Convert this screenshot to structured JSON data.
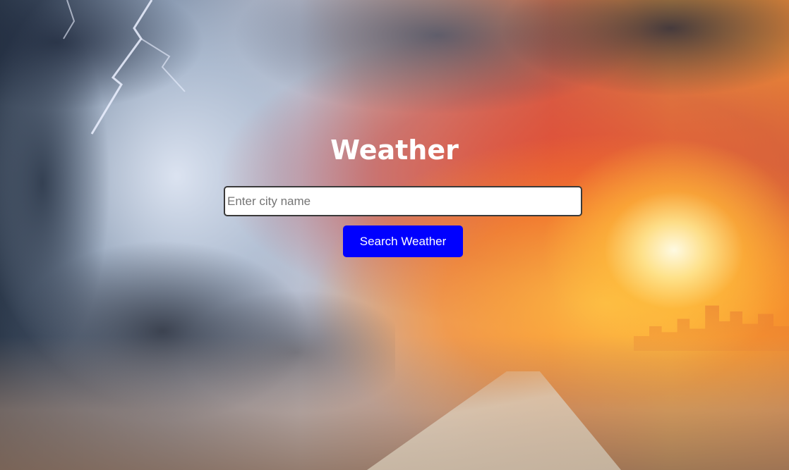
{
  "app": {
    "title": "Weather"
  },
  "search": {
    "value": "",
    "placeholder": "Enter city name",
    "button_label": "Search Weather"
  },
  "background": {
    "description_icon": "storm-and-sunset-image"
  },
  "colors": {
    "button_background": "#0000ff",
    "button_text": "#ffffff",
    "title_text": "#ffffff",
    "input_border": "#3a3a3a"
  }
}
